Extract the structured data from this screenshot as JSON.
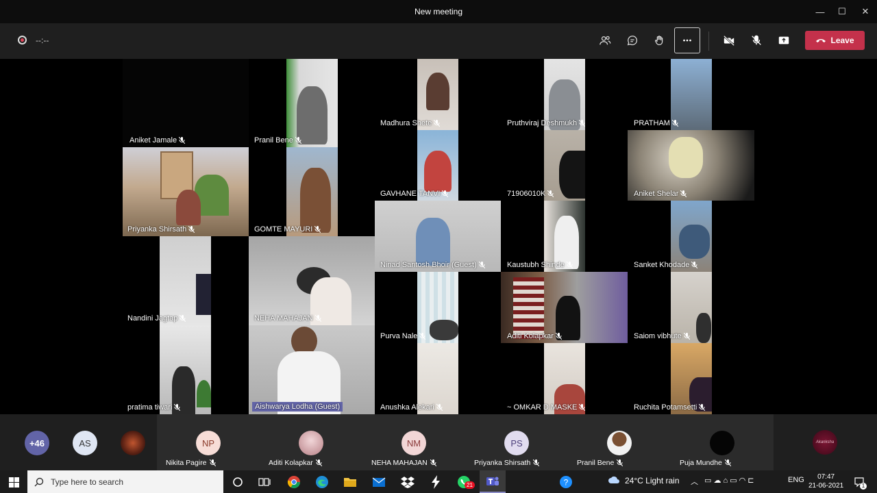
{
  "window": {
    "title": "New meeting",
    "min": "—",
    "max": "☐",
    "close": "✕"
  },
  "toolbar": {
    "timer": "--:--",
    "leave_label": "Leave",
    "icons": [
      "people-icon",
      "chat-icon",
      "raise-hand-icon",
      "more-options-icon",
      "camera-off-icon",
      "mic-off-icon",
      "share-screen-icon"
    ]
  },
  "participants": [
    {
      "name": "Aniket Jamale"
    },
    {
      "name": "Pranil Bene"
    },
    {
      "name": "Madhura  Shete"
    },
    {
      "name": "Pruthviraj Deshmukh"
    },
    {
      "name": "PRATHAM"
    },
    {
      "name": "Priyanka Shirsath"
    },
    {
      "name": "GOMTE MAYURI"
    },
    {
      "name": "GAVHANE TANVI"
    },
    {
      "name": "71906010K"
    },
    {
      "name": "Aniket Shelar"
    },
    {
      "name": "Nandini Jagtap"
    },
    {
      "name": "NEHA MAHAJAN"
    },
    {
      "name": "Ninad Santosh Bhoir (Guest)"
    },
    {
      "name": "Kaustubh Shinde"
    },
    {
      "name": "Sanket Khodade"
    },
    {
      "name": "Purva Nale"
    },
    {
      "name": "Aditi Kolapkar"
    },
    {
      "name": "Saiom vibhute"
    },
    {
      "name": "pratima tiwari"
    },
    {
      "name": "Aishwarya Lodha (Guest)"
    },
    {
      "name": "Anushka Alekari"
    },
    {
      "name": "~ OMKAR D MASKE"
    },
    {
      "name": "Ruchita Potamsetti"
    }
  ],
  "bottom": {
    "overflow_count": "+46",
    "as_initials": "AS",
    "people": [
      {
        "initials": "NP",
        "name": "Nikita Pagire"
      },
      {
        "initials": "",
        "name": "Aditi Kolapkar"
      },
      {
        "initials": "NM",
        "name": "NEHA MAHAJAN"
      },
      {
        "initials": "PS",
        "name": "Priyanka Shirsath"
      },
      {
        "initials": "",
        "name": "Pranil Bene"
      },
      {
        "initials": "",
        "name": "Puja Mundhe"
      }
    ],
    "last_avatar_text": "Akanksha"
  },
  "taskbar": {
    "search_placeholder": "Type here to search",
    "weather": "24°C  Light rain",
    "lang": "ENG",
    "time": "07:47",
    "date": "21-06-2021",
    "whatsapp_badge": "21",
    "notif_count": "1"
  },
  "colors": {
    "accent": "#6264a7",
    "leave": "#c4314b",
    "toolbar_bg": "#1f1f1f"
  }
}
